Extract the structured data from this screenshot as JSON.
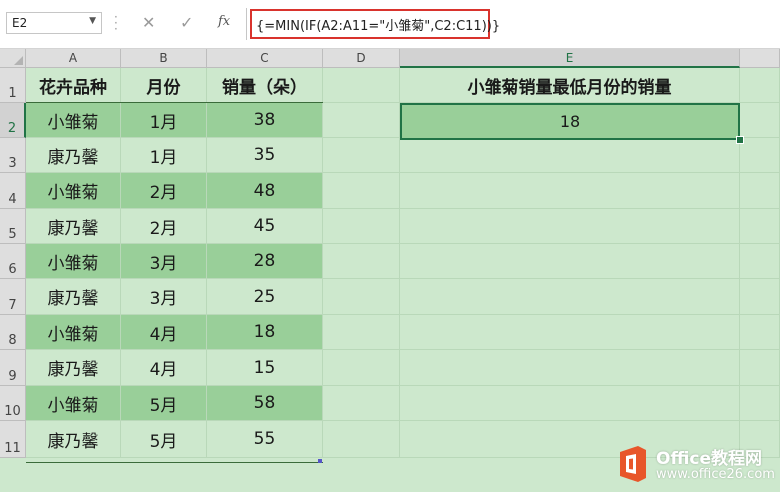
{
  "formula_bar": {
    "name_box": "E2",
    "cancel_icon": "close-icon",
    "enter_icon": "check-icon",
    "fx_label": "fx",
    "formula": "{=MIN(IF(A2:A11=\"小雏菊\",C2:C11))}",
    "highlight_color": "#d9332d"
  },
  "columns": [
    "A",
    "B",
    "C",
    "D",
    "E"
  ],
  "rows": [
    "1",
    "2",
    "3",
    "4",
    "5",
    "6",
    "7",
    "8",
    "9",
    "10",
    "11"
  ],
  "headers": {
    "a1": "花卉品种",
    "b1": "月份",
    "c1": "销量（朵）",
    "e1": "小雏菊销量最低月份的销量"
  },
  "data_rows": [
    {
      "variety": "小雏菊",
      "month": "1月",
      "sales": "38"
    },
    {
      "variety": "康乃馨",
      "month": "1月",
      "sales": "35"
    },
    {
      "variety": "小雏菊",
      "month": "2月",
      "sales": "48"
    },
    {
      "variety": "康乃馨",
      "month": "2月",
      "sales": "45"
    },
    {
      "variety": "小雏菊",
      "month": "3月",
      "sales": "28"
    },
    {
      "variety": "康乃馨",
      "month": "3月",
      "sales": "25"
    },
    {
      "variety": "小雏菊",
      "month": "4月",
      "sales": "18"
    },
    {
      "variety": "康乃馨",
      "month": "4月",
      "sales": "15"
    },
    {
      "variety": "小雏菊",
      "month": "5月",
      "sales": "58"
    },
    {
      "variety": "康乃馨",
      "month": "5月",
      "sales": "55"
    }
  ],
  "result": {
    "cell": "E2",
    "value": "18"
  },
  "colors": {
    "sheet_bg": "#cde8cd",
    "band": "#99cf99",
    "selection": "#217346"
  },
  "watermark": {
    "logo_icon": "office-logo-icon",
    "title": "Office教程网",
    "url": "www.office26.com"
  }
}
